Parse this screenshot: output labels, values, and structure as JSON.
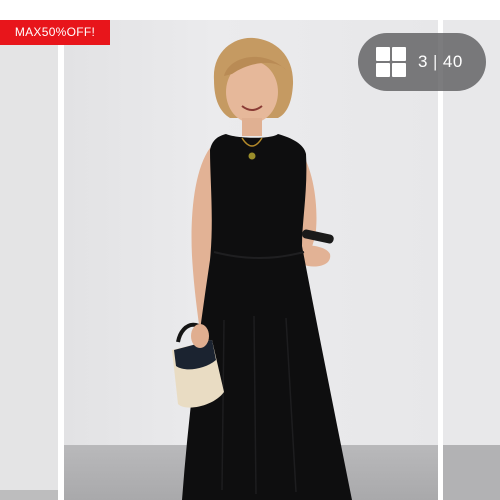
{
  "badge": {
    "label": "MAX50%OFF!",
    "color": "#e8151b"
  },
  "gallery": {
    "current": "3",
    "separator": "|",
    "total": "40",
    "icon": "grid-icon"
  },
  "product": {
    "dress_color": "#0e0e0f",
    "bag_color": "#e9dcc3"
  }
}
